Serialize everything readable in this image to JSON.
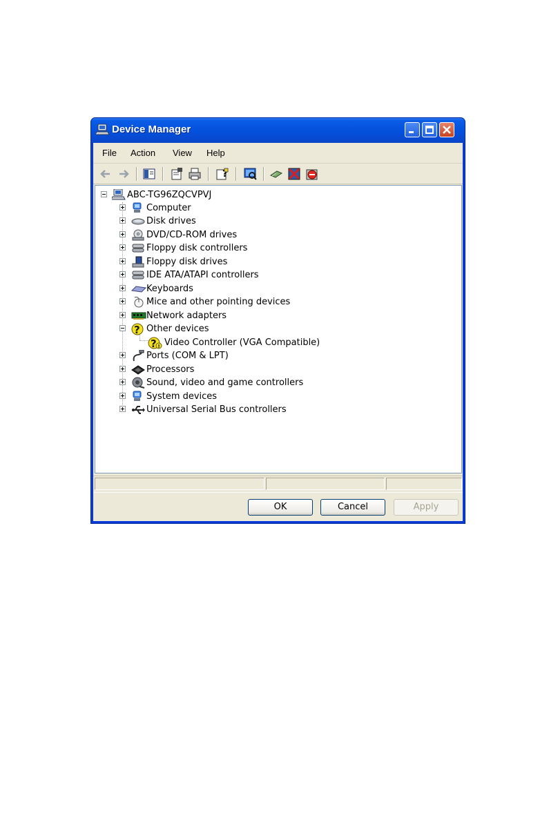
{
  "window": {
    "title": "Device Manager"
  },
  "menu": [
    "File",
    "Action",
    "View",
    "Help"
  ],
  "toolbar_icons": [
    "back-arrow-icon",
    "forward-arrow-icon",
    "show-hide-tree-icon",
    "properties-icon",
    "print-icon",
    "help-icon",
    "scan-hardware-icon",
    "update-driver-icon",
    "disable-device-icon",
    "uninstall-device-icon"
  ],
  "tree": {
    "root": "ABC-TG96ZQCVPVJ",
    "categories": [
      {
        "label": "Computer",
        "icon": "computer-icon"
      },
      {
        "label": "Disk drives",
        "icon": "disk-drive-icon"
      },
      {
        "label": "DVD/CD-ROM drives",
        "icon": "dvd-drive-icon"
      },
      {
        "label": "Floppy disk controllers",
        "icon": "controller-icon"
      },
      {
        "label": "Floppy disk drives",
        "icon": "floppy-drive-icon"
      },
      {
        "label": "IDE ATA/ATAPI controllers",
        "icon": "ide-controller-icon"
      },
      {
        "label": "Keyboards",
        "icon": "keyboard-icon"
      },
      {
        "label": "Mice and other pointing devices",
        "icon": "mouse-icon"
      },
      {
        "label": "Network adapters",
        "icon": "network-adapter-icon"
      },
      {
        "label": "Other devices",
        "icon": "unknown-device-icon",
        "expanded": true,
        "children": [
          "Video Controller (VGA Compatible)"
        ]
      },
      {
        "label": "Ports (COM & LPT)",
        "icon": "port-icon"
      },
      {
        "label": "Processors",
        "icon": "processor-icon"
      },
      {
        "label": "Sound, video and game controllers",
        "icon": "sound-icon"
      },
      {
        "label": "System devices",
        "icon": "system-device-icon"
      },
      {
        "label": "Universal Serial Bus controllers",
        "icon": "usb-icon"
      }
    ]
  },
  "buttons": {
    "ok": "OK",
    "cancel": "Cancel",
    "apply": "Apply"
  }
}
